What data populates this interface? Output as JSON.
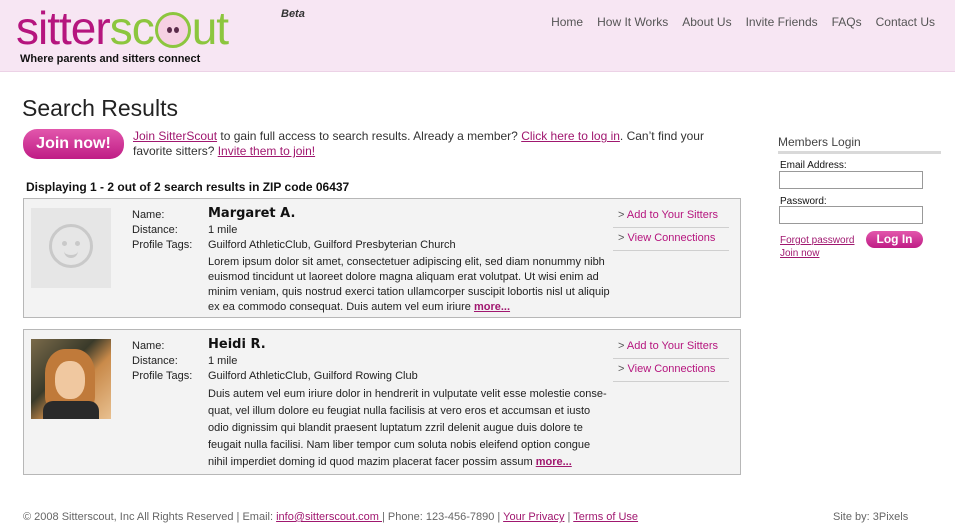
{
  "brand": {
    "logo_part1": "sitter",
    "logo_part2": "sc",
    "logo_part3": "ut",
    "beta": "Beta",
    "tagline": "Where parents and sitters connect",
    "colors": {
      "magenta": "#b5157e",
      "green": "#8cc63e",
      "header_bg": "#f7e6f3"
    }
  },
  "nav": [
    "Home",
    "How It Works",
    "About Us",
    "Invite Friends",
    "FAQs",
    "Contact Us"
  ],
  "page_title": "Search Results",
  "join_button": "Join now!",
  "intro": {
    "join_link": "Join SitterScout",
    "text1": " to gain full access to search results. Already a member? ",
    "login_link": "Click here to log in",
    "text2": ". Can’t find your favorite sitters? ",
    "invite_link": "Invite them to join!"
  },
  "results_summary": "Displaying 1 - 2 out of 2 search results in ZIP code 06437",
  "field_labels": {
    "name": "Name:",
    "distance": "Distance:",
    "tags": "Profile Tags:"
  },
  "results": [
    {
      "name": "Margaret A.",
      "distance": "1 mile",
      "tags": "Guilford AthleticClub, Guilford Presbyterian Church",
      "bio": "Lorem ipsum dolor sit amet, consectetuer adipiscing elit, sed diam nonummy nibh euismod tincidunt ut laoreet dolore magna aliquam erat volutpat. Ut wisi enim ad minim veniam, quis nostrud exerci tation ullamcorper suscipit lobortis nisl ut aliquip ex ea commodo consequat. Duis autem vel eum iriure",
      "more": "more...",
      "photo": "placeholder-baby-icon"
    },
    {
      "name": "Heidi R.",
      "distance": "1 mile",
      "tags": "Guilford AthleticClub, Guilford Rowing Club",
      "bio": "Duis autem vel eum iriure dolor in hendrerit in vulputate velit esse molestie conse-quat, vel illum dolore eu feugiat nulla facilisis at vero eros et accumsan et iusto odio dignissim qui blandit praesent luptatum zzril delenit augue duis dolore te feugait nulla facilisi. Nam liber tempor cum soluta nobis eleifend option congue nihil imperdiet doming id quod mazim placerat facer possim assum",
      "more": "more...",
      "photo": "profile-photo"
    }
  ],
  "actions": {
    "add": "Add to Your Sitters",
    "view": "View Connections",
    "arrow": ">"
  },
  "login": {
    "title": "Members Login",
    "email_label": "Email Address:",
    "password_label": "Password:",
    "forgot": "Forgot password",
    "join": "Join now",
    "button": "Log In",
    "email_value": "",
    "password_value": ""
  },
  "footer": {
    "copyright": "© 2008 Sitterscout, Inc  All Rights Reserved | Email: ",
    "email": "info@sitterscout.com ",
    "phone": " | Phone: 123-456-7890  | ",
    "privacy": "Your Privacy",
    "sep": "  | ",
    "terms": "Terms of Use ",
    "siteby": "Site by: 3Pixels"
  }
}
